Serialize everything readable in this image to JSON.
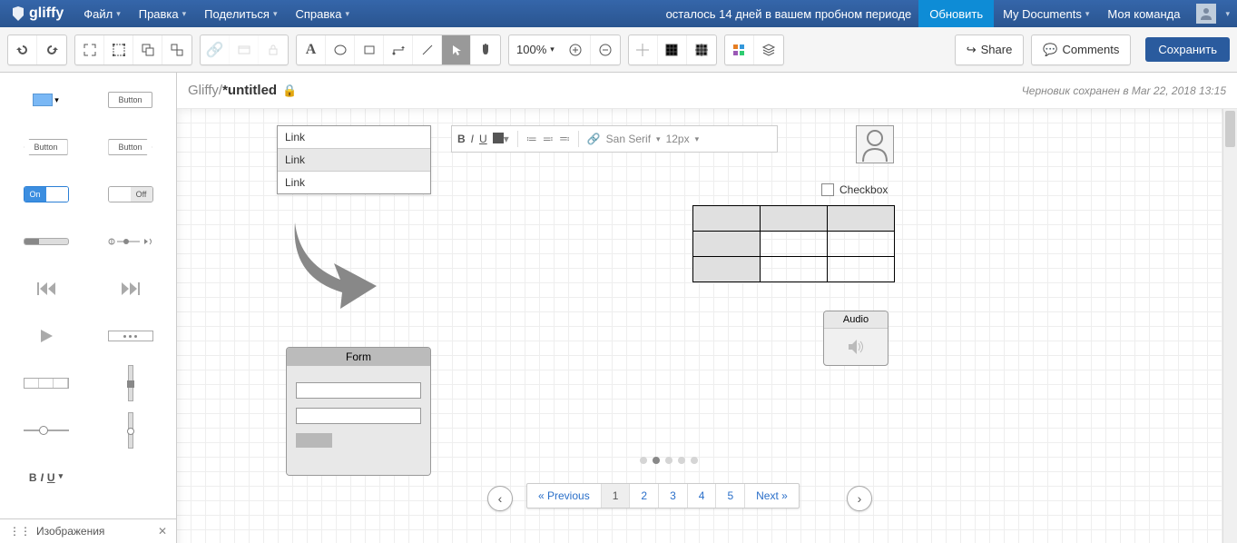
{
  "header": {
    "logo": "gliffy",
    "menus": {
      "file": "Файл",
      "edit": "Правка",
      "share": "Поделиться",
      "help": "Справка"
    },
    "trial": "осталось 14 дней в вашем пробном периоде",
    "upgrade": "Обновить",
    "mydocs": "My Documents",
    "team": "Моя команда"
  },
  "toolbar": {
    "zoom": "100%",
    "share": "Share",
    "comments": "Comments",
    "save": "Сохранить"
  },
  "breadcrumb": {
    "app": "Gliffy",
    "sep": " / ",
    "title": "*untitled"
  },
  "draft": "Черновик сохранен в Mar 22, 2018 13:15",
  "sidebar": {
    "button": "Button",
    "on": "On",
    "off": "Off",
    "footer": "Изображения"
  },
  "canvas": {
    "links": [
      "Link",
      "Link",
      "Link"
    ],
    "rtb": {
      "sans": "San Serif",
      "size": "12px"
    },
    "checkbox": "Checkbox",
    "audio": "Audio",
    "form": "Form",
    "pager": {
      "prev": "« Previous",
      "next": "Next »",
      "pages": [
        "1",
        "2",
        "3",
        "4",
        "5"
      ]
    }
  }
}
